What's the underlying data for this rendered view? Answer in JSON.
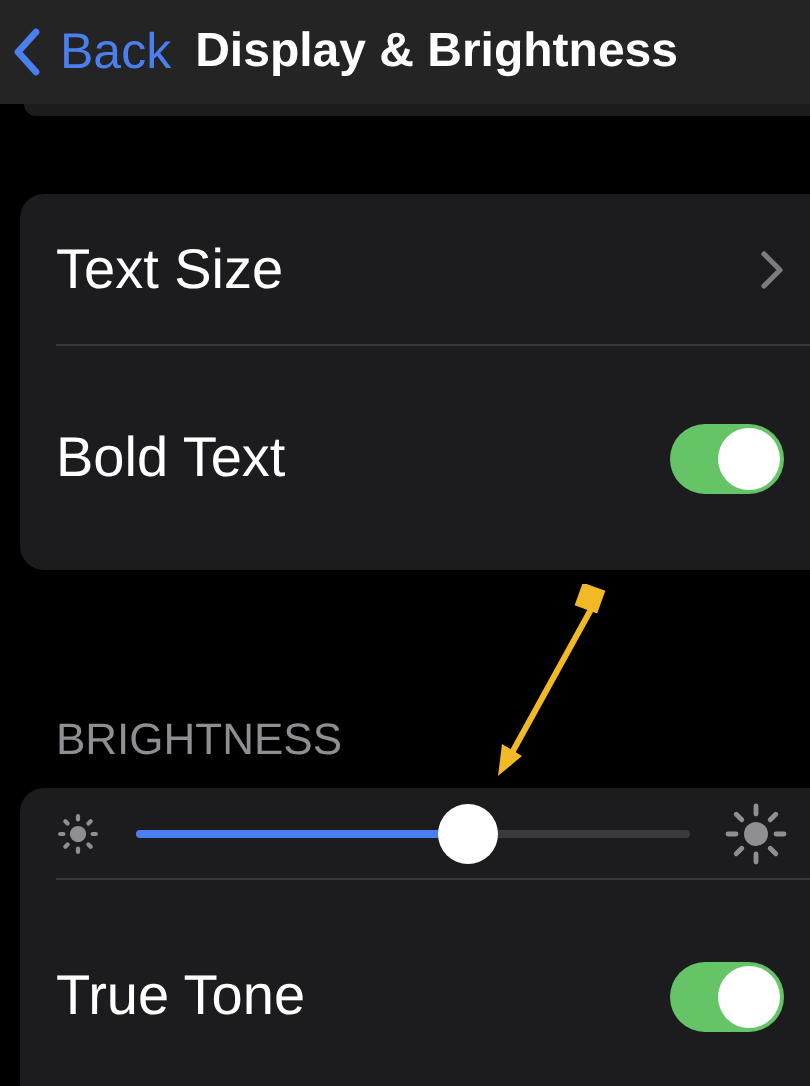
{
  "nav": {
    "back": "Back",
    "title": "Display & Brightness"
  },
  "groups": [
    {
      "rows": [
        {
          "kind": "link",
          "label": "Text Size"
        },
        {
          "kind": "toggle",
          "label": "Bold Text",
          "on": true
        }
      ]
    },
    {
      "header": "BRIGHTNESS",
      "rows": [
        {
          "kind": "slider",
          "level": 0.6
        },
        {
          "kind": "toggle",
          "label": "True Tone",
          "on": true
        }
      ]
    }
  ]
}
